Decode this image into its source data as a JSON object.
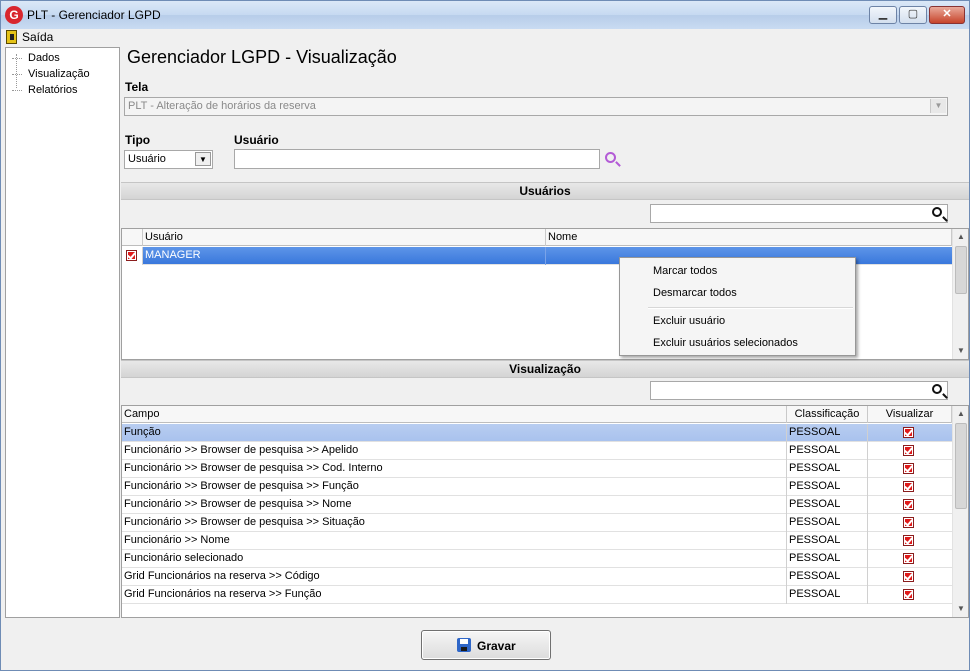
{
  "window": {
    "title": "PLT - Gerenciador LGPD",
    "app_icon": "G",
    "controls": {
      "minimize": "▁",
      "maximize": "▢",
      "close": "✕"
    }
  },
  "menu": {
    "exit_label": "Saída"
  },
  "tree": {
    "items": [
      "Dados",
      "Visualização",
      "Relatórios"
    ]
  },
  "page": {
    "title": "Gerenciador LGPD - Visualização"
  },
  "form": {
    "tela_label": "Tela",
    "tela_value": "PLT - Alteração de horários da reserva",
    "tipo_label": "Tipo",
    "tipo_value": "Usuário",
    "usuario_label": "Usuário",
    "usuario_value": ""
  },
  "usuarios_section": {
    "header": "Usuários",
    "filter_value": "",
    "columns": [
      "Usuário",
      "Nome"
    ],
    "rows": [
      {
        "checked": true,
        "usuario": "MANAGER",
        "nome": ""
      }
    ]
  },
  "context_menu": {
    "items": [
      "Marcar todos",
      "Desmarcar todos",
      "Excluir usuário",
      "Excluir usuários selecionados"
    ]
  },
  "visualizacao_section": {
    "header": "Visualização",
    "filter_value": "",
    "columns": [
      "Campo",
      "Classificação",
      "Visualizar"
    ],
    "rows": [
      {
        "campo": "Função",
        "classificacao": "PESSOAL",
        "visualizar": true
      },
      {
        "campo": "Funcionário >> Browser de pesquisa >> Apelido",
        "classificacao": "PESSOAL",
        "visualizar": true
      },
      {
        "campo": "Funcionário >> Browser de pesquisa >> Cod. Interno",
        "classificacao": "PESSOAL",
        "visualizar": true
      },
      {
        "campo": "Funcionário >> Browser de pesquisa >> Função",
        "classificacao": "PESSOAL",
        "visualizar": true
      },
      {
        "campo": "Funcionário >> Browser de pesquisa >> Nome",
        "classificacao": "PESSOAL",
        "visualizar": true
      },
      {
        "campo": "Funcionário >> Browser de pesquisa >> Situação",
        "classificacao": "PESSOAL",
        "visualizar": true
      },
      {
        "campo": "Funcionário >> Nome",
        "classificacao": "PESSOAL",
        "visualizar": true
      },
      {
        "campo": "Funcionário selecionado",
        "classificacao": "PESSOAL",
        "visualizar": true
      },
      {
        "campo": "Grid Funcionários na reserva >> Código",
        "classificacao": "PESSOAL",
        "visualizar": true
      },
      {
        "campo": "Grid Funcionários na reserva >> Função",
        "classificacao": "PESSOAL",
        "visualizar": true
      }
    ]
  },
  "footer": {
    "save_label": "Gravar"
  },
  "colors": {
    "selection": "#3a78dc",
    "checkbox": "#e01a1a",
    "search_icon": "#b35bd6"
  }
}
